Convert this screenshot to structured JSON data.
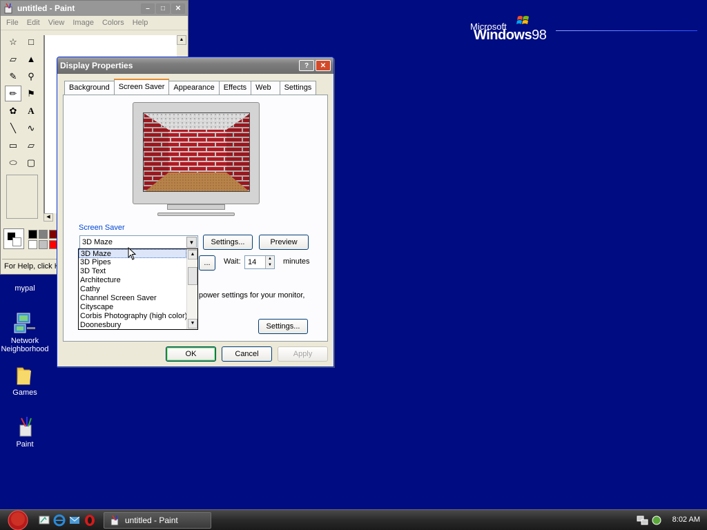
{
  "desktop": {
    "logo_microsoft": "Microsoft",
    "logo_windows": "Windows",
    "logo_version": "98",
    "icons": [
      {
        "label": "mypal"
      },
      {
        "label": "Network Neighborhood"
      },
      {
        "label": "Games"
      },
      {
        "label": "Paint"
      }
    ]
  },
  "paint": {
    "title": "untitled - Paint",
    "menu": [
      "File",
      "Edit",
      "View",
      "Image",
      "Colors",
      "Help"
    ],
    "status": "For Help, click H"
  },
  "dialog": {
    "title": "Display Properties",
    "help_btn": "?",
    "close_btn": "✕",
    "tabs": [
      "Background",
      "Screen Saver",
      "Appearance",
      "Effects",
      "Web",
      "Settings"
    ],
    "selected_tab": "Screen Saver",
    "screen_saver_label": "Screen Saver",
    "screen_saver_value": "3D Maze",
    "settings_btn": "Settings...",
    "preview_btn": "Preview",
    "password_btn": "...",
    "wait_label": "Wait:",
    "wait_value": "14",
    "minutes_label": "minutes",
    "power_text": "power settings for your monitor,",
    "power_settings_btn": "Settings...",
    "ok_btn": "OK",
    "cancel_btn": "Cancel",
    "apply_btn": "Apply",
    "dropdown_items": [
      "3D Maze",
      "3D Pipes",
      "3D Text",
      "Architecture",
      "Cathy",
      "Channel Screen Saver",
      "Cityscape",
      "Corbis Photography (high color)",
      "Doonesbury"
    ]
  },
  "taskbar": {
    "task_label": "untitled - Paint",
    "clock": "8:02 AM"
  },
  "colors": {
    "desktop": "#000c82",
    "dialog_bg": "#ece9d8",
    "tab_accent": "#e68b2c",
    "link_blue": "#0046d5",
    "selection": "#316ac5"
  }
}
